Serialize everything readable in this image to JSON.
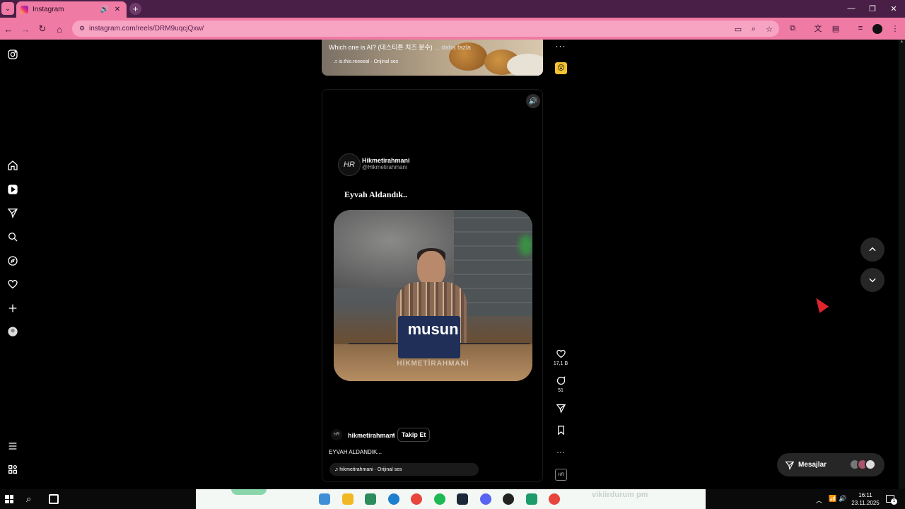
{
  "browser": {
    "tab_title": "Instagram",
    "url": "instagram.com/reels/DRM9uqcjQxw/",
    "new_tab_symbol": "+",
    "window_controls": [
      "—",
      "❐",
      "✕"
    ]
  },
  "prev_reel": {
    "caption": "Which one is AI? (데스티튼 치즈 분수)",
    "more": "... daha fazla",
    "audio": "♫ is.this.reeeeal · Orijinal ses",
    "audio_thumb": "😲"
  },
  "reel": {
    "post_author": "Hikmetirahmani",
    "post_handle": "@Hikmetirahmani",
    "post_avatar": "HR",
    "post_text": "Eyvah Aldandık..",
    "video_caption": "musun",
    "video_watermark": "HİKMETİRAHMANİ",
    "owner": "hikmetirahmani",
    "owner_dot": "•",
    "follow_label": "Takip Et",
    "caption": "EYVAH ALDANDIK...",
    "audio": "♫ hikmetirahmani · Orijinal ses",
    "audio_thumb": "HR",
    "mute_icon": "🔊"
  },
  "actions": {
    "likes": "17,1 B",
    "comments": "51",
    "more": "···"
  },
  "messages": {
    "label": "Mesajlar"
  },
  "taskbar": {
    "time": "16:11",
    "date": "23.11.2025",
    "center_blur_text": "vikiirdurum pm",
    "notification_count": "1",
    "apps": [
      {
        "name": "copilot",
        "color": "#3f8fd8"
      },
      {
        "name": "file-explorer",
        "color": "#f2b824"
      },
      {
        "name": "notepad",
        "color": "#2c8c5c"
      },
      {
        "name": "edge",
        "color": "#1d7fce"
      },
      {
        "name": "chrome",
        "color": "#e8453c"
      },
      {
        "name": "spotify",
        "color": "#1db954"
      },
      {
        "name": "steam",
        "color": "#1b2838"
      },
      {
        "name": "discord",
        "color": "#5865f2"
      },
      {
        "name": "obs",
        "color": "#222"
      },
      {
        "name": "app-green",
        "color": "#1e9b6b"
      },
      {
        "name": "chrome-profile",
        "color": "#e8453c"
      }
    ]
  },
  "colors": {
    "tabbar": "#4a1f47",
    "toolbar": "#ef7aa4",
    "page_bg": "#000000",
    "cursor": "#e0242d"
  }
}
